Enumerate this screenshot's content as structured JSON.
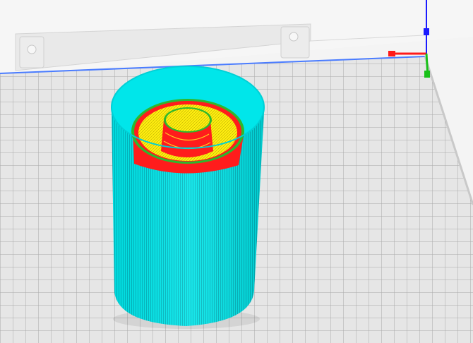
{
  "viewport": {
    "view": "layer-preview",
    "background_color": "#f4f4f4",
    "build_plate": {
      "fill_color": "#e6e6e6",
      "grid_color": "#9a9a9a",
      "edge_color": "#4a7cff"
    },
    "axes": {
      "x_color": "#ff1a1a",
      "y_color": "#18c018",
      "z_color": "#1a1aff"
    },
    "model": {
      "name": "",
      "icon": "cylinder-print-preview",
      "wall_color": "#00e6ea",
      "layer_colors": {
        "outer_wall": "#ff1c1c",
        "inner_wall": "#2db82d",
        "infill": "#ffee10",
        "top_bottom": "#ff2a1a"
      }
    }
  }
}
